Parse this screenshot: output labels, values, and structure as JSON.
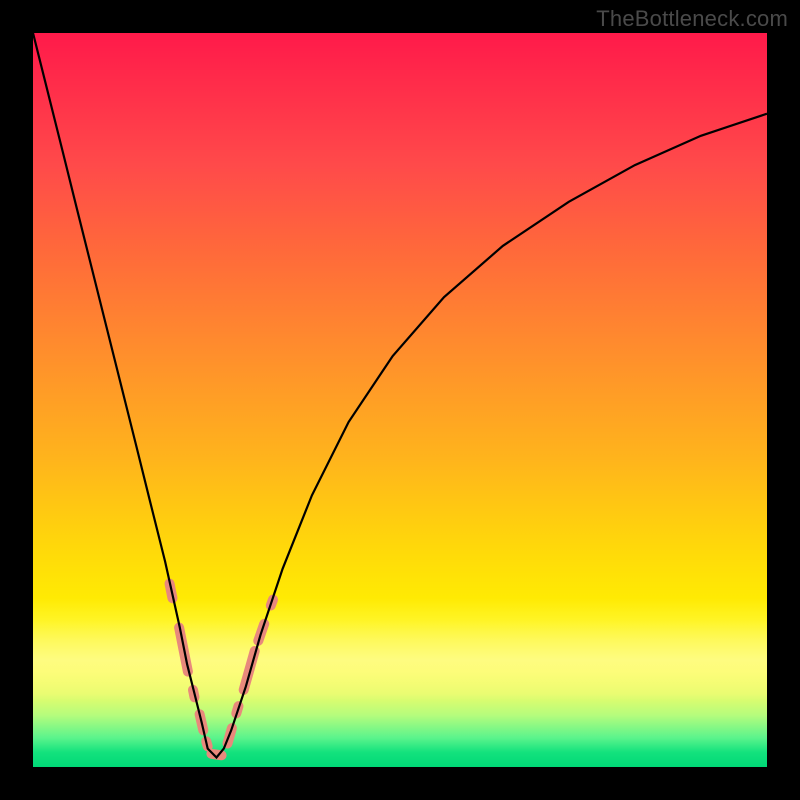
{
  "watermark": "TheBottleneck.com",
  "colors": {
    "background": "#000000",
    "curve": "#000000",
    "marker": "#e8897c",
    "watermark_text": "#4a4a4a"
  },
  "chart_data": {
    "type": "line",
    "title": "",
    "xlabel": "",
    "ylabel": "",
    "xlim": [
      0,
      100
    ],
    "ylim": [
      0,
      100
    ],
    "grid": false,
    "legend": false,
    "series": [
      {
        "name": "bottleneck-curve",
        "x": [
          0,
          2,
          4,
          6,
          8,
          10,
          12,
          14,
          16,
          18,
          20,
          21,
          22,
          23,
          23.8,
          25,
          26,
          27,
          29,
          31,
          34,
          38,
          43,
          49,
          56,
          64,
          73,
          82,
          91,
          100
        ],
        "y": [
          100,
          92,
          84,
          76,
          68,
          60,
          52,
          44,
          36,
          28,
          19,
          14,
          10,
          6,
          2.5,
          1.3,
          2.5,
          5,
          11,
          18,
          27,
          37,
          47,
          56,
          64,
          71,
          77,
          82,
          86,
          89
        ]
      }
    ],
    "minimum": {
      "x": 25,
      "y": 1.3
    },
    "marker_segments": [
      {
        "x0": 18.6,
        "y0": 25.0,
        "x1": 19.0,
        "y1": 23.0
      },
      {
        "x0": 19.9,
        "y0": 19.0,
        "x1": 21.1,
        "y1": 13.0
      },
      {
        "x0": 21.8,
        "y0": 10.5,
        "x1": 22.0,
        "y1": 9.5
      },
      {
        "x0": 22.7,
        "y0": 7.2,
        "x1": 23.2,
        "y1": 5.0
      },
      {
        "x0": 23.6,
        "y0": 3.5,
        "x1": 23.8,
        "y1": 2.8
      },
      {
        "x0": 24.3,
        "y0": 1.8,
        "x1": 25.7,
        "y1": 1.6
      },
      {
        "x0": 26.5,
        "y0": 3.2,
        "x1": 27.1,
        "y1": 5.3
      },
      {
        "x0": 27.7,
        "y0": 7.3,
        "x1": 28.0,
        "y1": 8.3
      },
      {
        "x0": 28.7,
        "y0": 10.5,
        "x1": 30.2,
        "y1": 15.8
      },
      {
        "x0": 30.7,
        "y0": 17.2,
        "x1": 31.5,
        "y1": 19.5
      },
      {
        "x0": 32.4,
        "y0": 22.0,
        "x1": 32.7,
        "y1": 22.8
      }
    ],
    "gradient_stops": [
      {
        "pos": 0.0,
        "color": "#ff1a4a"
      },
      {
        "pos": 0.3,
        "color": "#ff6a3a"
      },
      {
        "pos": 0.58,
        "color": "#ffb41c"
      },
      {
        "pos": 0.8,
        "color": "#fff200"
      },
      {
        "pos": 1.0,
        "color": "#00d877"
      }
    ]
  }
}
